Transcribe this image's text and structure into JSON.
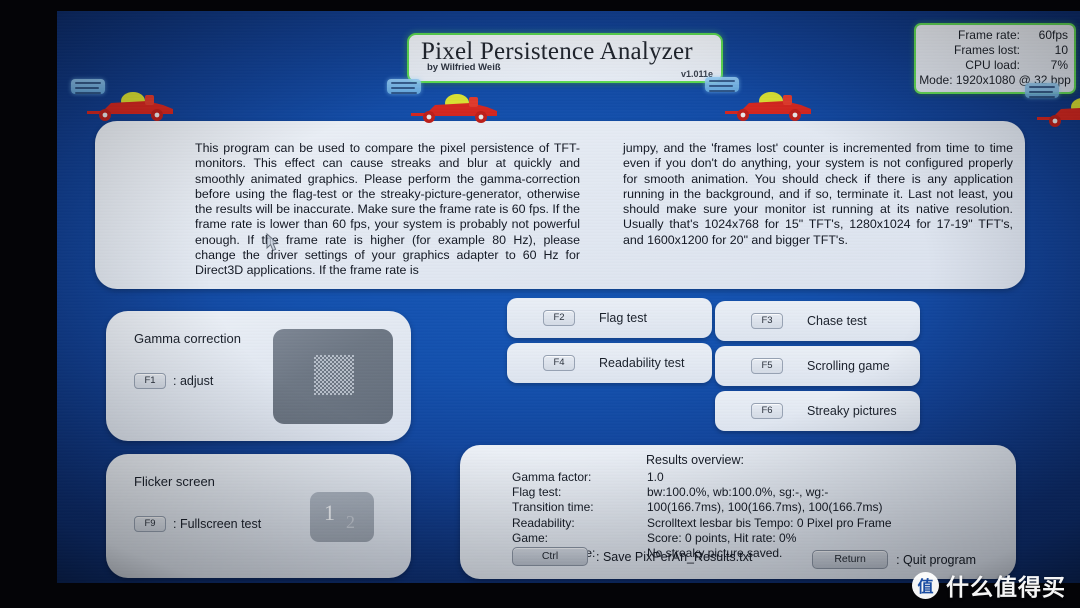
{
  "app": {
    "title_main": "Pixel Persistence Analyzer",
    "title_sub": "by Wilfried Weiß",
    "version": "v1.011e"
  },
  "stats": {
    "frame_rate_label": "Frame rate:",
    "frame_rate_value": "60fps",
    "frames_lost_label": "Frames lost:",
    "frames_lost_value": "10",
    "cpu_load_label": "CPU load:",
    "cpu_load_value": "7%",
    "mode_line": "Mode: 1920x1080 @ 32 bpp"
  },
  "info": {
    "left": "This program can be used to compare the pixel persistence of TFT-monitors. This effect can cause streaks and blur at quickly and smoothly animated graphics. Please perform the gamma-correction before using the flag-test or the streaky-picture-generator, otherwise the results will be inaccurate. Make sure the frame rate is 60 fps. If the frame rate is lower than 60 fps, your system is probably not powerful enough. If the frame rate is higher (for example 80 Hz), please change the driver settings of your graphics adapter to 60 Hz for Direct3D applications. If the frame rate is",
    "right": "jumpy, and the 'frames lost' counter is incremented from time to time even if you don't do anything, your system is not configured properly for smooth animation. You should check if there is any application running in the background, and if so, terminate it. Last not least, you should make sure your monitor ist running at its native resolution. Usually that's 1024x768 for 15\" TFT's, 1280x1024 for 17-19\" TFT's, and 1600x1200 for 20\" and bigger TFT's."
  },
  "gamma_panel": {
    "title": "Gamma correction",
    "key": "F1",
    "action": ": adjust"
  },
  "flicker_panel": {
    "title": "Flicker screen",
    "key": "F9",
    "action": ": Fullscreen test",
    "swatch_number": "1",
    "swatch_number_ghost": "2"
  },
  "tests": [
    {
      "key": "F2",
      "label": "Flag test"
    },
    {
      "key": "F4",
      "label": "Readability test"
    },
    {
      "key": "F3",
      "label": "Chase test"
    },
    {
      "key": "F5",
      "label": "Scrolling game"
    },
    {
      "key": "F6",
      "label": "Streaky pictures"
    }
  ],
  "results": {
    "heading": "Results overview:",
    "rows": [
      {
        "key": "Gamma factor:",
        "value": "1.0"
      },
      {
        "key": "Flag test:",
        "value": "bw:100.0%, wb:100.0%, sg:-, wg:-"
      },
      {
        "key": "Transition time:",
        "value": "100(166.7ms), 100(166.7ms), 100(166.7ms)"
      },
      {
        "key": "Readability:",
        "value": "Scrolltext lesbar bis Tempo: 0 Pixel pro Frame"
      },
      {
        "key": "Game:",
        "value": "Score: 0 points, Hit rate: 0%"
      },
      {
        "key": "Streaky picture:",
        "value": "No streaky picture saved."
      }
    ],
    "ctrl_key": "Ctrl",
    "ctrl_text": ": Save PixPerAn_Results.txt",
    "return_key": "Return",
    "return_text": ": Quit program"
  },
  "watermark": {
    "badge": "值",
    "text": "什么值得买"
  },
  "icons": {
    "cursor": "mouse-pointer-icon",
    "car": "race-car-icon",
    "sign": "roadside-sign-icon"
  },
  "colors": {
    "desktop_blue": "#1350ad",
    "panel_light": "#e6ecf5",
    "accent_green": "#5ddc52",
    "car_red": "#d4261f",
    "text_dark": "#151b26"
  }
}
